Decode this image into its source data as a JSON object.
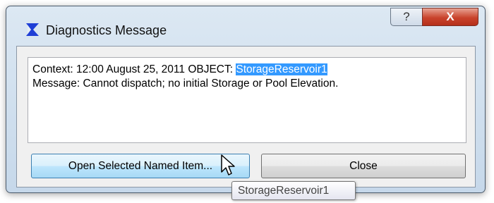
{
  "window": {
    "title": "Diagnostics Message",
    "help_label": "?",
    "close_label": "X"
  },
  "message": {
    "context_prefix": "Context: 12:00 August 25, 2011 OBJECT: ",
    "context_object": "StorageReservoir1",
    "message_line": "Message: Cannot dispatch; no initial Storage or Pool Elevation."
  },
  "buttons": {
    "open_selected": "Open Selected Named Item...",
    "close": "Close"
  },
  "tooltip": {
    "text": "StorageReservoir1"
  },
  "colors": {
    "selection": "#3399ff",
    "app_icon_blue": "#1f3fd6",
    "close_red": "#c9432c"
  }
}
